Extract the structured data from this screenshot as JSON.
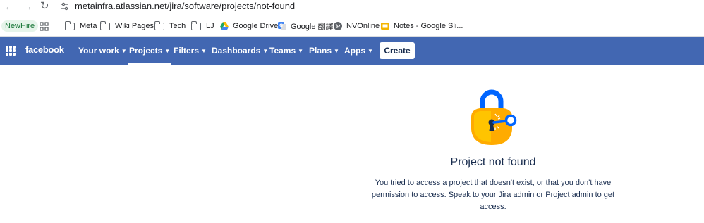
{
  "browser": {
    "url": "metainfra.atlassian.net/jira/software/projects/not-found"
  },
  "bookmarks": [
    {
      "label": "NewHire",
      "icon": "badge"
    },
    {
      "label": "",
      "icon": "apps-grid-icon"
    },
    {
      "label": "Meta",
      "icon": "folder-icon"
    },
    {
      "label": "Wiki Pages",
      "icon": "folder-icon"
    },
    {
      "label": "Tech",
      "icon": "folder-icon"
    },
    {
      "label": "LJ",
      "icon": "folder-icon"
    },
    {
      "label": "Google Drive",
      "icon": "google-drive-icon"
    },
    {
      "label": "Google 翻譯",
      "icon": "google-translate-icon"
    },
    {
      "label": "NVOnline",
      "icon": "globe-icon"
    },
    {
      "label": "Notes - Google Sli...",
      "icon": "google-slides-icon"
    }
  ],
  "nav": {
    "logo": "facebook",
    "items": [
      {
        "label": "Your work",
        "active": false
      },
      {
        "label": "Projects",
        "active": true
      },
      {
        "label": "Filters",
        "active": false
      },
      {
        "label": "Dashboards",
        "active": false
      },
      {
        "label": "Teams",
        "active": false
      },
      {
        "label": "Plans",
        "active": false
      },
      {
        "label": "Apps",
        "active": false
      }
    ],
    "create_label": "Create",
    "bar_color": "#4267b2"
  },
  "main": {
    "title": "Project not found",
    "description_lines": [
      "You tried to access a project that doesn't exist, or that you don't have",
      "permission to access. Speak to your Jira admin or Project admin to get",
      "access."
    ]
  }
}
